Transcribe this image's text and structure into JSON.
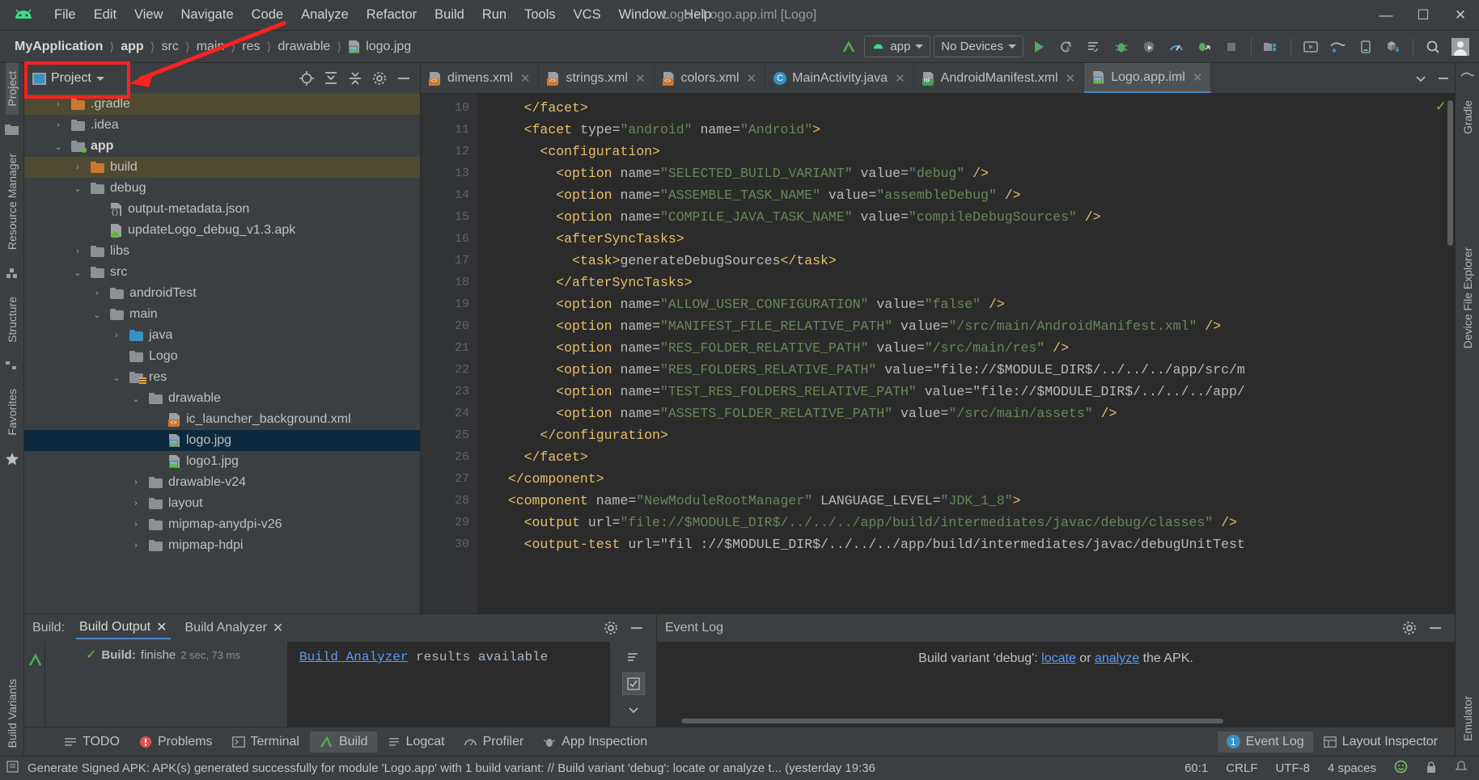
{
  "window": {
    "title": "Logo - Logo.app.iml [Logo]",
    "minimize": "─",
    "maximize": "☐",
    "close": "✕"
  },
  "menu": {
    "items": [
      "File",
      "Edit",
      "View",
      "Navigate",
      "Code",
      "Analyze",
      "Refactor",
      "Build",
      "Run",
      "Tools",
      "VCS",
      "Window",
      "Help"
    ]
  },
  "breadcrumb": {
    "items": [
      "MyApplication",
      "app",
      "src",
      "main",
      "res",
      "drawable"
    ],
    "file": "logo.jpg"
  },
  "toolbar": {
    "run_config": "app",
    "device": "No Devices",
    "icons": [
      "make-project-icon",
      "run-icon",
      "apply-changes-icon",
      "apply-code-changes-icon",
      "debug-icon",
      "attach-debugger-icon",
      "profiler-icon",
      "run-with-coverage-icon",
      "stop-icon",
      "sdk-manager-icon",
      "avd-manager-icon",
      "sync-gradle-icon",
      "device-manager-icon",
      "sdk-download-icon",
      "search-everywhere-icon",
      "avatar-icon"
    ]
  },
  "left_strip": {
    "tabs": [
      "Project",
      "Resource Manager",
      "Structure",
      "Favorites"
    ],
    "icons": [
      "project-folder-icon",
      "resource-manager-icon",
      "structure-icon",
      "favorites-star-icon"
    ]
  },
  "right_strip": {
    "tabs": [
      "Gradle",
      "Device File Explorer",
      "Emulator"
    ]
  },
  "project_panel": {
    "title": "Project",
    "icons": [
      "locate-icon",
      "expand-all-icon",
      "collapse-all-icon",
      "settings-gear-icon",
      "hide-icon"
    ],
    "tree": [
      {
        "label": ".gradle",
        "depth": 1,
        "arrow": "collapsed",
        "icon": "folder-orange",
        "state": "build-hl"
      },
      {
        "label": ".idea",
        "depth": 1,
        "arrow": "collapsed",
        "icon": "folder",
        "state": ""
      },
      {
        "label": "app",
        "depth": 1,
        "arrow": "expanded",
        "icon": "folder-module",
        "state": "",
        "bold": true
      },
      {
        "label": "build",
        "depth": 2,
        "arrow": "collapsed",
        "icon": "folder-orange",
        "state": "build-hl"
      },
      {
        "label": "debug",
        "depth": 2,
        "arrow": "expanded",
        "icon": "folder",
        "state": ""
      },
      {
        "label": "output-metadata.json",
        "depth": 3,
        "arrow": "none",
        "icon": "file-json",
        "state": ""
      },
      {
        "label": "updateLogo_debug_v1.3.apk",
        "depth": 3,
        "arrow": "none",
        "icon": "file-apk",
        "state": ""
      },
      {
        "label": "libs",
        "depth": 2,
        "arrow": "collapsed",
        "icon": "folder",
        "state": ""
      },
      {
        "label": "src",
        "depth": 2,
        "arrow": "expanded",
        "icon": "folder",
        "state": ""
      },
      {
        "label": "androidTest",
        "depth": 3,
        "arrow": "collapsed",
        "icon": "folder",
        "state": ""
      },
      {
        "label": "main",
        "depth": 3,
        "arrow": "expanded",
        "icon": "folder",
        "state": ""
      },
      {
        "label": "java",
        "depth": 4,
        "arrow": "collapsed",
        "icon": "folder-blue",
        "state": ""
      },
      {
        "label": "Logo",
        "depth": 4,
        "arrow": "none",
        "icon": "folder",
        "state": ""
      },
      {
        "label": "res",
        "depth": 4,
        "arrow": "expanded",
        "icon": "folder-res",
        "state": ""
      },
      {
        "label": "drawable",
        "depth": 5,
        "arrow": "expanded",
        "icon": "folder",
        "state": ""
      },
      {
        "label": "ic_launcher_background.xml",
        "depth": 6,
        "arrow": "none",
        "icon": "file-xml",
        "state": ""
      },
      {
        "label": "logo.jpg",
        "depth": 6,
        "arrow": "none",
        "icon": "file-image",
        "state": "sel"
      },
      {
        "label": "logo1.jpg",
        "depth": 6,
        "arrow": "none",
        "icon": "file-image",
        "state": ""
      },
      {
        "label": "drawable-v24",
        "depth": 5,
        "arrow": "collapsed",
        "icon": "folder",
        "state": ""
      },
      {
        "label": "layout",
        "depth": 5,
        "arrow": "collapsed",
        "icon": "folder",
        "state": ""
      },
      {
        "label": "mipmap-anydpi-v26",
        "depth": 5,
        "arrow": "collapsed",
        "icon": "folder",
        "state": ""
      },
      {
        "label": "mipmap-hdpi",
        "depth": 5,
        "arrow": "collapsed",
        "icon": "folder",
        "state": ""
      }
    ]
  },
  "editor": {
    "tabs": [
      {
        "label": "dimens.xml",
        "icon": "file-xml",
        "active": false
      },
      {
        "label": "strings.xml",
        "icon": "file-xml",
        "active": false
      },
      {
        "label": "colors.xml",
        "icon": "file-xml",
        "active": false
      },
      {
        "label": "MainActivity.java",
        "icon": "file-java",
        "active": false
      },
      {
        "label": "AndroidManifest.xml",
        "icon": "file-manifest",
        "active": false
      },
      {
        "label": "Logo.app.iml",
        "icon": "file-image",
        "active": true
      }
    ],
    "line_numbers": [
      10,
      11,
      12,
      13,
      14,
      15,
      16,
      17,
      18,
      19,
      20,
      21,
      22,
      23,
      24,
      25,
      26,
      27,
      28,
      29,
      30
    ],
    "lines": [
      "    </facet>",
      "    <facet type=\"android\" name=\"Android\">",
      "      <configuration>",
      "        <option name=\"SELECTED_BUILD_VARIANT\" value=\"debug\" />",
      "        <option name=\"ASSEMBLE_TASK_NAME\" value=\"assembleDebug\" />",
      "        <option name=\"COMPILE_JAVA_TASK_NAME\" value=\"compileDebugSources\" />",
      "        <afterSyncTasks>",
      "          <task>generateDebugSources</task>",
      "        </afterSyncTasks>",
      "        <option name=\"ALLOW_USER_CONFIGURATION\" value=\"false\" />",
      "        <option name=\"MANIFEST_FILE_RELATIVE_PATH\" value=\"/src/main/AndroidManifest.xml\" />",
      "        <option name=\"RES_FOLDER_RELATIVE_PATH\" value=\"/src/main/res\" />",
      "        <option name=\"RES_FOLDERS_RELATIVE_PATH\" value=\"file://$MODULE_DIR$/../../../app/src/m",
      "        <option name=\"TEST_RES_FOLDERS_RELATIVE_PATH\" value=\"file://$MODULE_DIR$/../../../app/",
      "        <option name=\"ASSETS_FOLDER_RELATIVE_PATH\" value=\"/src/main/assets\" />",
      "      </configuration>",
      "    </facet>",
      "  </component>",
      "  <component name=\"NewModuleRootManager\" LANGUAGE_LEVEL=\"JDK_1_8\">",
      "    <output url=\"file://$MODULE_DIR$/../../../app/build/intermediates/javac/debug/classes\" />",
      "    <output-test url=\"fil ://$MODULE_DIR$/../../../app/build/intermediates/javac/debugUnitTest"
    ]
  },
  "build_panel": {
    "label": "Build:",
    "tabs": [
      "Build Output",
      "Build Analyzer"
    ],
    "active_tab": "Build Output",
    "status_title": "Build:",
    "status_detail": "finishe",
    "status_time": "2 sec, 73 ms",
    "console_link": "Build Analyzer",
    "console_text": " results available",
    "icons": [
      "settings-gear-icon",
      "hide-icon",
      "restart-icon",
      "toggle-tasks-icon"
    ]
  },
  "event_log": {
    "title": "Event Log",
    "message_prefix": "Build variant 'debug': ",
    "link1": "locate",
    "message_mid": " or ",
    "link2": "analyze",
    "message_suffix": " the APK.",
    "icons": [
      "settings-gear-icon",
      "hide-icon"
    ]
  },
  "tool_windows": {
    "left": [
      {
        "label": "TODO",
        "icon": "todo-icon",
        "active": false
      },
      {
        "label": "Problems",
        "icon": "problems-icon",
        "active": false
      },
      {
        "label": "Terminal",
        "icon": "terminal-icon",
        "active": false
      },
      {
        "label": "Build",
        "icon": "build-hammer-icon",
        "active": true
      },
      {
        "label": "Logcat",
        "icon": "logcat-icon",
        "active": false
      },
      {
        "label": "Profiler",
        "icon": "profiler-gauge-icon",
        "active": false
      },
      {
        "label": "App Inspection",
        "icon": "app-inspection-icon",
        "active": false
      }
    ],
    "right": [
      {
        "label": "Event Log",
        "icon": "event-log-icon",
        "badge": "1",
        "active": true
      },
      {
        "label": "Layout Inspector",
        "icon": "layout-inspector-icon",
        "badge": "",
        "active": false
      }
    ]
  },
  "status_bar": {
    "message": "Generate Signed APK: APK(s) generated successfully for module 'Logo.app' with 1 build variant: // Build variant 'debug': locate or analyze t... (yesterday 19:36",
    "position": "60:1",
    "line_separator": "CRLF",
    "encoding": "UTF-8",
    "indent": "4 spaces",
    "icons": [
      "event-icon",
      "smiley-icon",
      "lock-icon",
      "notifications-icon"
    ]
  },
  "annotation": {
    "color": "#fb2222",
    "description": "red-rectangle-and-arrow-highlighting-project-button"
  }
}
